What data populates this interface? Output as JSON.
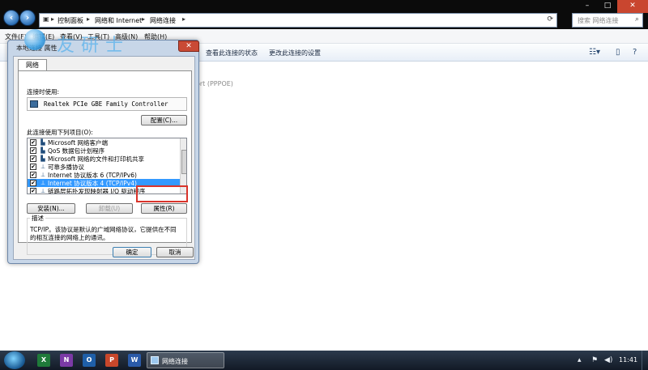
{
  "explorer": {
    "breadcrumbs": [
      "控制面板",
      "网络和 Internet",
      "网络连接"
    ],
    "search_placeholder": "搜索 网络连接",
    "menu": [
      "文件(F)",
      "编辑(E)",
      "查看(V)",
      "工具(T)",
      "高级(N)",
      "帮助(H)"
    ],
    "toolbar": [
      "查看此连接的状态",
      "更改此连接的设置"
    ],
    "peek_text": "ort (PPPOE)"
  },
  "watermark": {
    "text": "友研士"
  },
  "dialog": {
    "title": "本地连接 属性",
    "close_glyph": "✕",
    "tab": "网络",
    "connect_using_label": "连接时使用:",
    "adapter": "Realtek PCIe GBE Family Controller",
    "configure_button": "配置(C)...",
    "items_label": "此连接使用下列项目(O):",
    "items": [
      {
        "label": "Microsoft 网络客户端",
        "checked": true,
        "icon": "network-client-icon"
      },
      {
        "label": "QoS 数据包计划程序",
        "checked": true,
        "icon": "qos-icon"
      },
      {
        "label": "Microsoft 网络的文件和打印机共享",
        "checked": true,
        "icon": "file-share-icon"
      },
      {
        "label": "可靠多播协议",
        "checked": true,
        "icon": "protocol-icon"
      },
      {
        "label": "Internet 协议版本 6 (TCP/IPv6)",
        "checked": true,
        "icon": "protocol-icon"
      },
      {
        "label": "Internet 协议版本 4 (TCP/IPv4)",
        "checked": true,
        "icon": "protocol-icon",
        "selected": true
      },
      {
        "label": "链路层拓扑发现映射器 I/O 驱动程序",
        "checked": true,
        "icon": "protocol-icon"
      }
    ],
    "install_button": "安装(N)...",
    "uninstall_button": "卸载(U)",
    "properties_button": "属性(R)",
    "description_label": "描述",
    "description_text_1": "TCP/IP。该协议是默认的广域网络协议，它提供在不同",
    "description_text_2": "的相互连接的网络上的通讯。",
    "ok_button": "确定",
    "cancel_button": "取消"
  },
  "taskbar": {
    "apps": [
      {
        "letter": "X",
        "color": "#1f7a3a",
        "name": "excel-icon"
      },
      {
        "letter": "N",
        "color": "#7b3aa6",
        "name": "onenote-icon"
      },
      {
        "letter": "O",
        "color": "#1f5fa8",
        "name": "outlook-icon"
      },
      {
        "letter": "P",
        "color": "#c8472b",
        "name": "powerpoint-icon"
      },
      {
        "letter": "W",
        "color": "#2a5aa8",
        "name": "word-icon"
      }
    ],
    "active_window": "网络连接",
    "clock": "11:41"
  }
}
